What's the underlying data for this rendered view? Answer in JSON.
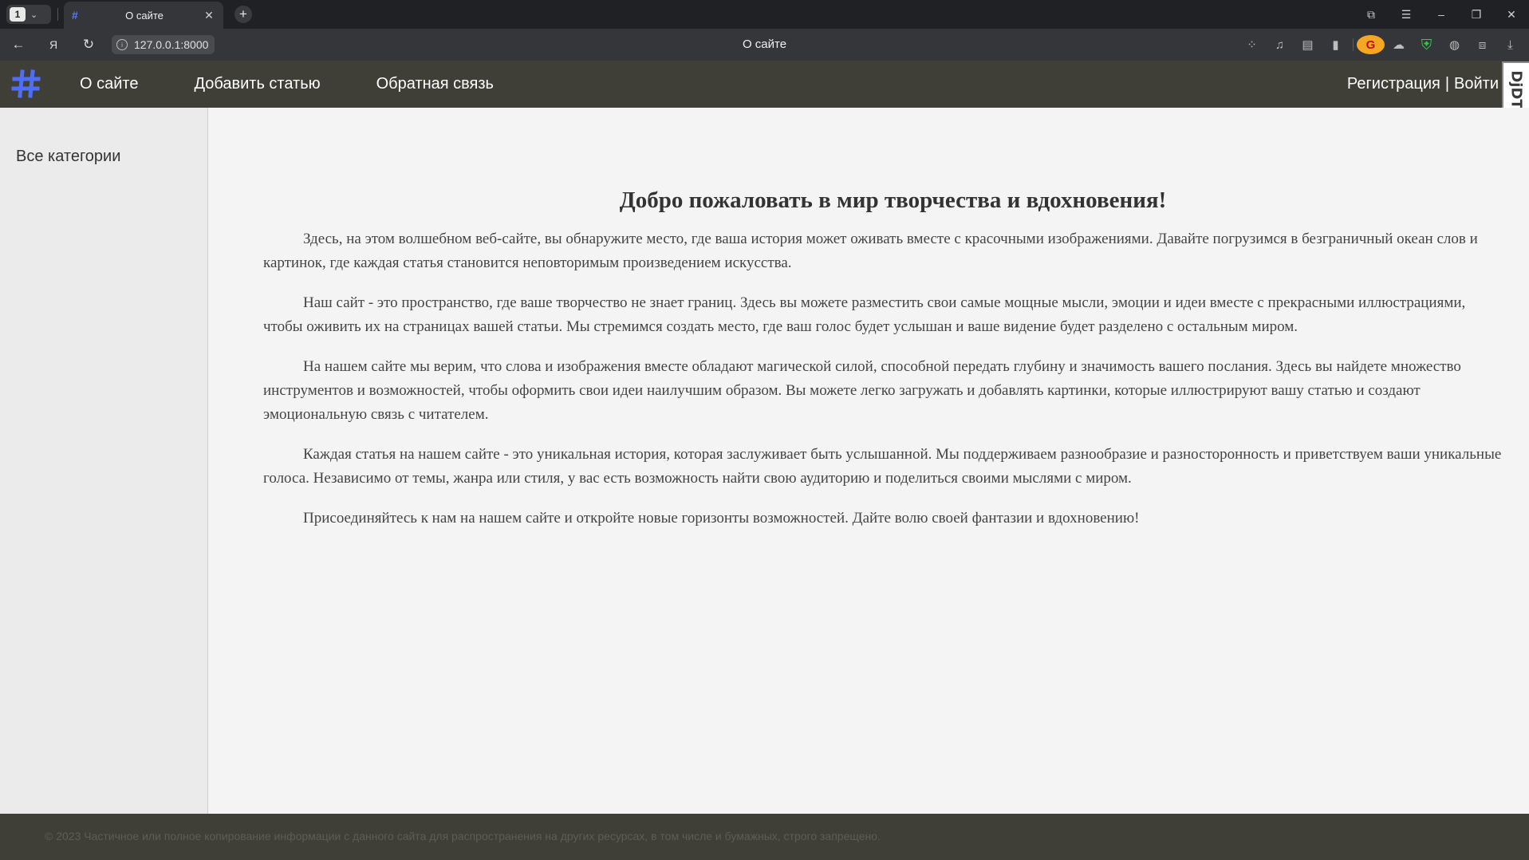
{
  "browser": {
    "tab_count": "1",
    "tab_title": "О сайте",
    "url": "127.0.0.1:8000",
    "window_title": "О сайте"
  },
  "site": {
    "nav": [
      {
        "label": "О сайте"
      },
      {
        "label": "Добавить статью"
      },
      {
        "label": "Обратная связь"
      }
    ],
    "auth": {
      "register": "Регистрация",
      "separator": "|",
      "login": "Войти"
    },
    "debug_toolbar_label": "DjDT",
    "logo_color": "#4f6df5"
  },
  "sidebar": {
    "all_categories": "Все категории"
  },
  "main": {
    "heading": "Добро пожаловать в мир творчества и вдохновения!",
    "paragraphs": [
      "Здесь, на этом волшебном веб-сайте, вы обнаружите место, где ваша история может оживать вместе с красочными изображениями. Давайте погрузимся в безграничный океан слов и картинок, где каждая статья становится неповторимым произведением искусства.",
      "Наш сайт - это пространство, где ваше творчество не знает границ. Здесь вы можете разместить свои самые мощные мысли, эмоции и идеи вместе с прекрасными иллюстрациями, чтобы оживить их на страницах вашей статьи. Мы стремимся создать место, где ваш голос будет услышан и ваше видение будет разделено с остальным миром.",
      "На нашем сайте мы верим, что слова и изображения вместе обладают магической силой, способной передать глубину и значимость вашего послания. Здесь вы найдете множество инструментов и возможностей, чтобы оформить свои идеи наилучшим образом. Вы можете легко загружать и добавлять картинки, которые иллюстрируют вашу статью и создают эмоциональную связь с читателем.",
      "Каждая статья на нашем сайте - это уникальная история, которая заслуживает быть услышанной. Мы поддерживаем разнообразие и разносторонность и приветствуем ваши уникальные голоса. Независимо от темы, жанра или стиля, у вас есть возможность найти свою аудиторию и поделиться своими мыслями с миром.",
      "Присоединяйтесь к нам на нашем сайте и откройте новые горизонты возможностей. Дайте волю своей фантазии и вдохновению!"
    ]
  },
  "footer": {
    "copyright": "© 2023 Частичное или полное копирование информации с данного сайта для распространения на других ресурсах, в том числе и бумажных, строго запрещено."
  }
}
